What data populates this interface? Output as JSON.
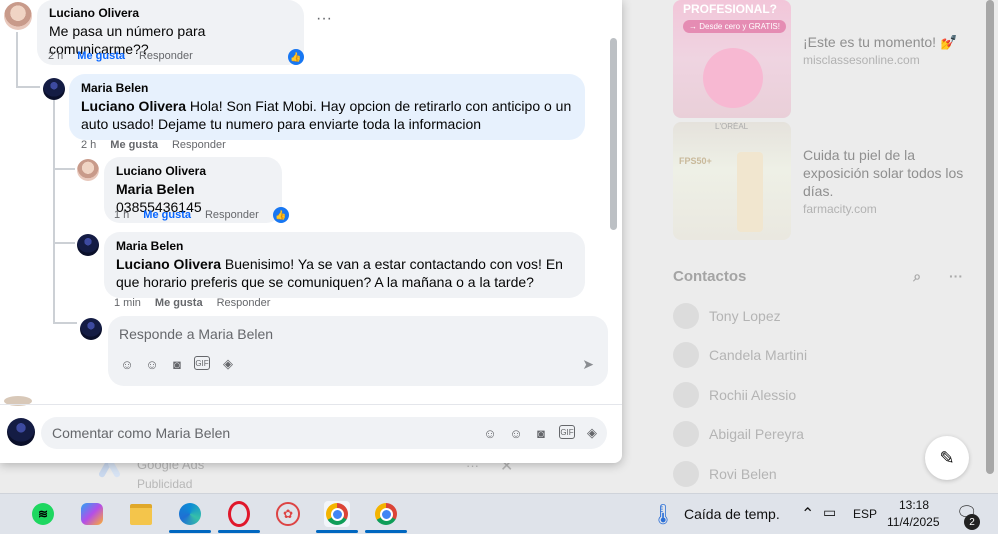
{
  "right_column": {
    "ad1": {
      "title": "¡Este es tu momento! 💅",
      "domain": "misclassesonline.com",
      "thumb_heading": "PROFESIONAL?",
      "thumb_tag": "→ Desde cero y GRATIS!"
    },
    "ad2": {
      "title": "Cuida tu piel de la exposición solar todos los días.",
      "domain": "farmacity.com",
      "thumb_brand": "L'ORÉAL",
      "thumb_tag": "FPS50+"
    },
    "contacts_title": "Contactos",
    "contacts": [
      "Tony Lopez",
      "Candela Martini",
      "Rochii Alessio",
      "Abigail Pereyra",
      "Rovi Belen"
    ],
    "under_ad": {
      "name": "Google Ads",
      "label": "Publicidad"
    }
  },
  "comments": {
    "c1": {
      "author": "Luciano Olivera",
      "text": "Me pasa un número para comunicarme??",
      "time": "2 h",
      "like": "Me gusta",
      "reply": "Responder"
    },
    "c2": {
      "author": "Maria Belen",
      "mention": "Luciano Olivera",
      "text": " Hola! Son Fiat Mobi. Hay opcion de retirarlo con anticipo o un auto usado! Dejame tu numero para enviarte toda la informacion",
      "time": "2 h",
      "like": "Me gusta",
      "reply": "Responder"
    },
    "c3": {
      "author": "Luciano Olivera",
      "mention": "Maria Belen",
      "text": " 03855436145",
      "time": "1 h",
      "like": "Me gusta",
      "reply": "Responder"
    },
    "c4": {
      "author": "Maria Belen",
      "mention": "Luciano Olivera",
      "text": " Buenisimo! Ya se van a estar contactando con vos! En que horario preferis que se comuniquen? A la mañana o a la tarde?",
      "time": "1 min",
      "like": "Me gusta",
      "reply": "Responder"
    }
  },
  "reply_box": {
    "placeholder": "Responde a Maria Belen"
  },
  "comment_box": {
    "placeholder": "Comentar como Maria Belen"
  },
  "taskbar": {
    "weather": "Caída de temp.",
    "language": "ESP",
    "time": "13:18",
    "date": "11/4/2025",
    "notifications": "2"
  },
  "icons": [
    "more-options-icon",
    "like-reaction-icon",
    "avatar-icon",
    "sticker-icon",
    "emoji-icon",
    "camera-icon",
    "gif-icon",
    "send-icon",
    "search-icon",
    "new-message-icon",
    "spotify-icon",
    "copilot-icon",
    "file-explorer-icon",
    "edge-icon",
    "opera-icon",
    "chrome-icon",
    "thermometer-icon",
    "chevron-up-icon",
    "battery-icon",
    "chat-icon"
  ],
  "colors": {
    "accent": "#0866ff",
    "like_blue": "#1877f2",
    "bubble": "#f0f2f5",
    "bubble_highlight": "#e7f1fd"
  }
}
